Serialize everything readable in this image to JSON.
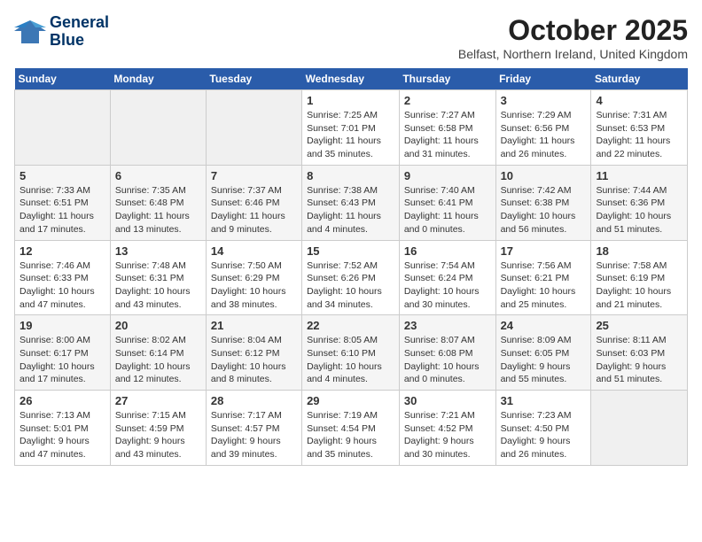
{
  "logo": {
    "line1": "General",
    "line2": "Blue"
  },
  "title": "October 2025",
  "subtitle": "Belfast, Northern Ireland, United Kingdom",
  "weekdays": [
    "Sunday",
    "Monday",
    "Tuesday",
    "Wednesday",
    "Thursday",
    "Friday",
    "Saturday"
  ],
  "weeks": [
    [
      {
        "day": "",
        "info": ""
      },
      {
        "day": "",
        "info": ""
      },
      {
        "day": "",
        "info": ""
      },
      {
        "day": "1",
        "info": "Sunrise: 7:25 AM\nSunset: 7:01 PM\nDaylight: 11 hours\nand 35 minutes."
      },
      {
        "day": "2",
        "info": "Sunrise: 7:27 AM\nSunset: 6:58 PM\nDaylight: 11 hours\nand 31 minutes."
      },
      {
        "day": "3",
        "info": "Sunrise: 7:29 AM\nSunset: 6:56 PM\nDaylight: 11 hours\nand 26 minutes."
      },
      {
        "day": "4",
        "info": "Sunrise: 7:31 AM\nSunset: 6:53 PM\nDaylight: 11 hours\nand 22 minutes."
      }
    ],
    [
      {
        "day": "5",
        "info": "Sunrise: 7:33 AM\nSunset: 6:51 PM\nDaylight: 11 hours\nand 17 minutes."
      },
      {
        "day": "6",
        "info": "Sunrise: 7:35 AM\nSunset: 6:48 PM\nDaylight: 11 hours\nand 13 minutes."
      },
      {
        "day": "7",
        "info": "Sunrise: 7:37 AM\nSunset: 6:46 PM\nDaylight: 11 hours\nand 9 minutes."
      },
      {
        "day": "8",
        "info": "Sunrise: 7:38 AM\nSunset: 6:43 PM\nDaylight: 11 hours\nand 4 minutes."
      },
      {
        "day": "9",
        "info": "Sunrise: 7:40 AM\nSunset: 6:41 PM\nDaylight: 11 hours\nand 0 minutes."
      },
      {
        "day": "10",
        "info": "Sunrise: 7:42 AM\nSunset: 6:38 PM\nDaylight: 10 hours\nand 56 minutes."
      },
      {
        "day": "11",
        "info": "Sunrise: 7:44 AM\nSunset: 6:36 PM\nDaylight: 10 hours\nand 51 minutes."
      }
    ],
    [
      {
        "day": "12",
        "info": "Sunrise: 7:46 AM\nSunset: 6:33 PM\nDaylight: 10 hours\nand 47 minutes."
      },
      {
        "day": "13",
        "info": "Sunrise: 7:48 AM\nSunset: 6:31 PM\nDaylight: 10 hours\nand 43 minutes."
      },
      {
        "day": "14",
        "info": "Sunrise: 7:50 AM\nSunset: 6:29 PM\nDaylight: 10 hours\nand 38 minutes."
      },
      {
        "day": "15",
        "info": "Sunrise: 7:52 AM\nSunset: 6:26 PM\nDaylight: 10 hours\nand 34 minutes."
      },
      {
        "day": "16",
        "info": "Sunrise: 7:54 AM\nSunset: 6:24 PM\nDaylight: 10 hours\nand 30 minutes."
      },
      {
        "day": "17",
        "info": "Sunrise: 7:56 AM\nSunset: 6:21 PM\nDaylight: 10 hours\nand 25 minutes."
      },
      {
        "day": "18",
        "info": "Sunrise: 7:58 AM\nSunset: 6:19 PM\nDaylight: 10 hours\nand 21 minutes."
      }
    ],
    [
      {
        "day": "19",
        "info": "Sunrise: 8:00 AM\nSunset: 6:17 PM\nDaylight: 10 hours\nand 17 minutes."
      },
      {
        "day": "20",
        "info": "Sunrise: 8:02 AM\nSunset: 6:14 PM\nDaylight: 10 hours\nand 12 minutes."
      },
      {
        "day": "21",
        "info": "Sunrise: 8:04 AM\nSunset: 6:12 PM\nDaylight: 10 hours\nand 8 minutes."
      },
      {
        "day": "22",
        "info": "Sunrise: 8:05 AM\nSunset: 6:10 PM\nDaylight: 10 hours\nand 4 minutes."
      },
      {
        "day": "23",
        "info": "Sunrise: 8:07 AM\nSunset: 6:08 PM\nDaylight: 10 hours\nand 0 minutes."
      },
      {
        "day": "24",
        "info": "Sunrise: 8:09 AM\nSunset: 6:05 PM\nDaylight: 9 hours\nand 55 minutes."
      },
      {
        "day": "25",
        "info": "Sunrise: 8:11 AM\nSunset: 6:03 PM\nDaylight: 9 hours\nand 51 minutes."
      }
    ],
    [
      {
        "day": "26",
        "info": "Sunrise: 7:13 AM\nSunset: 5:01 PM\nDaylight: 9 hours\nand 47 minutes."
      },
      {
        "day": "27",
        "info": "Sunrise: 7:15 AM\nSunset: 4:59 PM\nDaylight: 9 hours\nand 43 minutes."
      },
      {
        "day": "28",
        "info": "Sunrise: 7:17 AM\nSunset: 4:57 PM\nDaylight: 9 hours\nand 39 minutes."
      },
      {
        "day": "29",
        "info": "Sunrise: 7:19 AM\nSunset: 4:54 PM\nDaylight: 9 hours\nand 35 minutes."
      },
      {
        "day": "30",
        "info": "Sunrise: 7:21 AM\nSunset: 4:52 PM\nDaylight: 9 hours\nand 30 minutes."
      },
      {
        "day": "31",
        "info": "Sunrise: 7:23 AM\nSunset: 4:50 PM\nDaylight: 9 hours\nand 26 minutes."
      },
      {
        "day": "",
        "info": ""
      }
    ]
  ]
}
